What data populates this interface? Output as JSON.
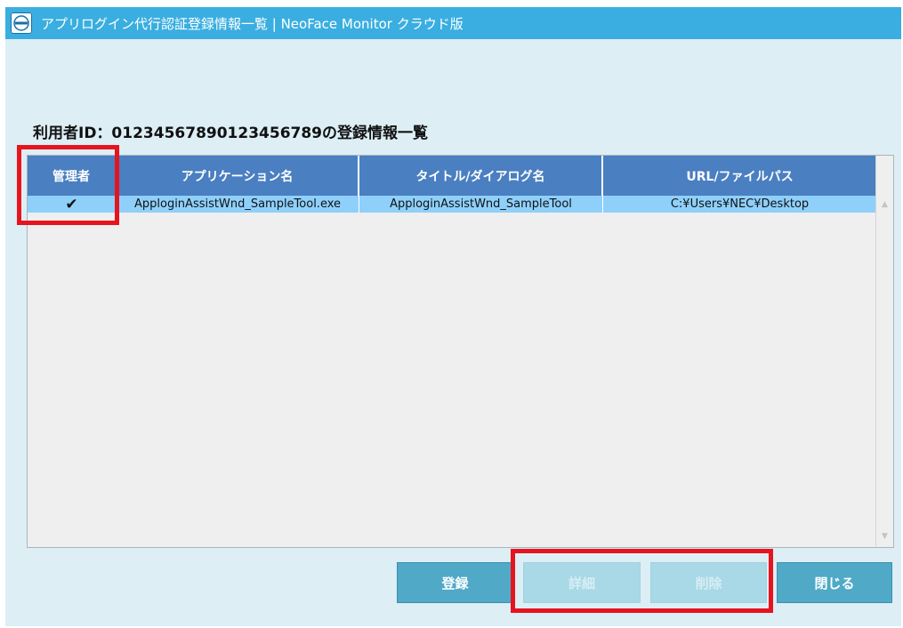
{
  "window": {
    "title": "アプリログイン代行認証登録情報一覧 | NeoFace Monitor クラウド版",
    "icon": "neoface-monitor-app-icon"
  },
  "heading": "利用者ID：01234567890123456789の登録情報一覧",
  "table": {
    "columns": [
      "管理者",
      "アプリケーション名",
      "タイトル/ダイアログ名",
      "URL/ファイルパス"
    ],
    "rows": [
      {
        "admin": "✔",
        "app_name": "ApploginAssistWnd_SampleTool.exe",
        "title": "ApploginAssistWnd_SampleTool",
        "path": "C:¥Users¥NEC¥Desktop"
      }
    ]
  },
  "buttons": {
    "register": "登録",
    "details": "詳細",
    "delete": "削除",
    "close": "閉じる"
  },
  "colors": {
    "titlebar": "#3aaee0",
    "window_bg": "#ddeef5",
    "header_bg": "#4a7fc1",
    "selected_row": "#8fd0fb",
    "button_active": "#4fa9c7",
    "button_disabled": "#a9d8e7",
    "highlight": "#e6141e"
  }
}
